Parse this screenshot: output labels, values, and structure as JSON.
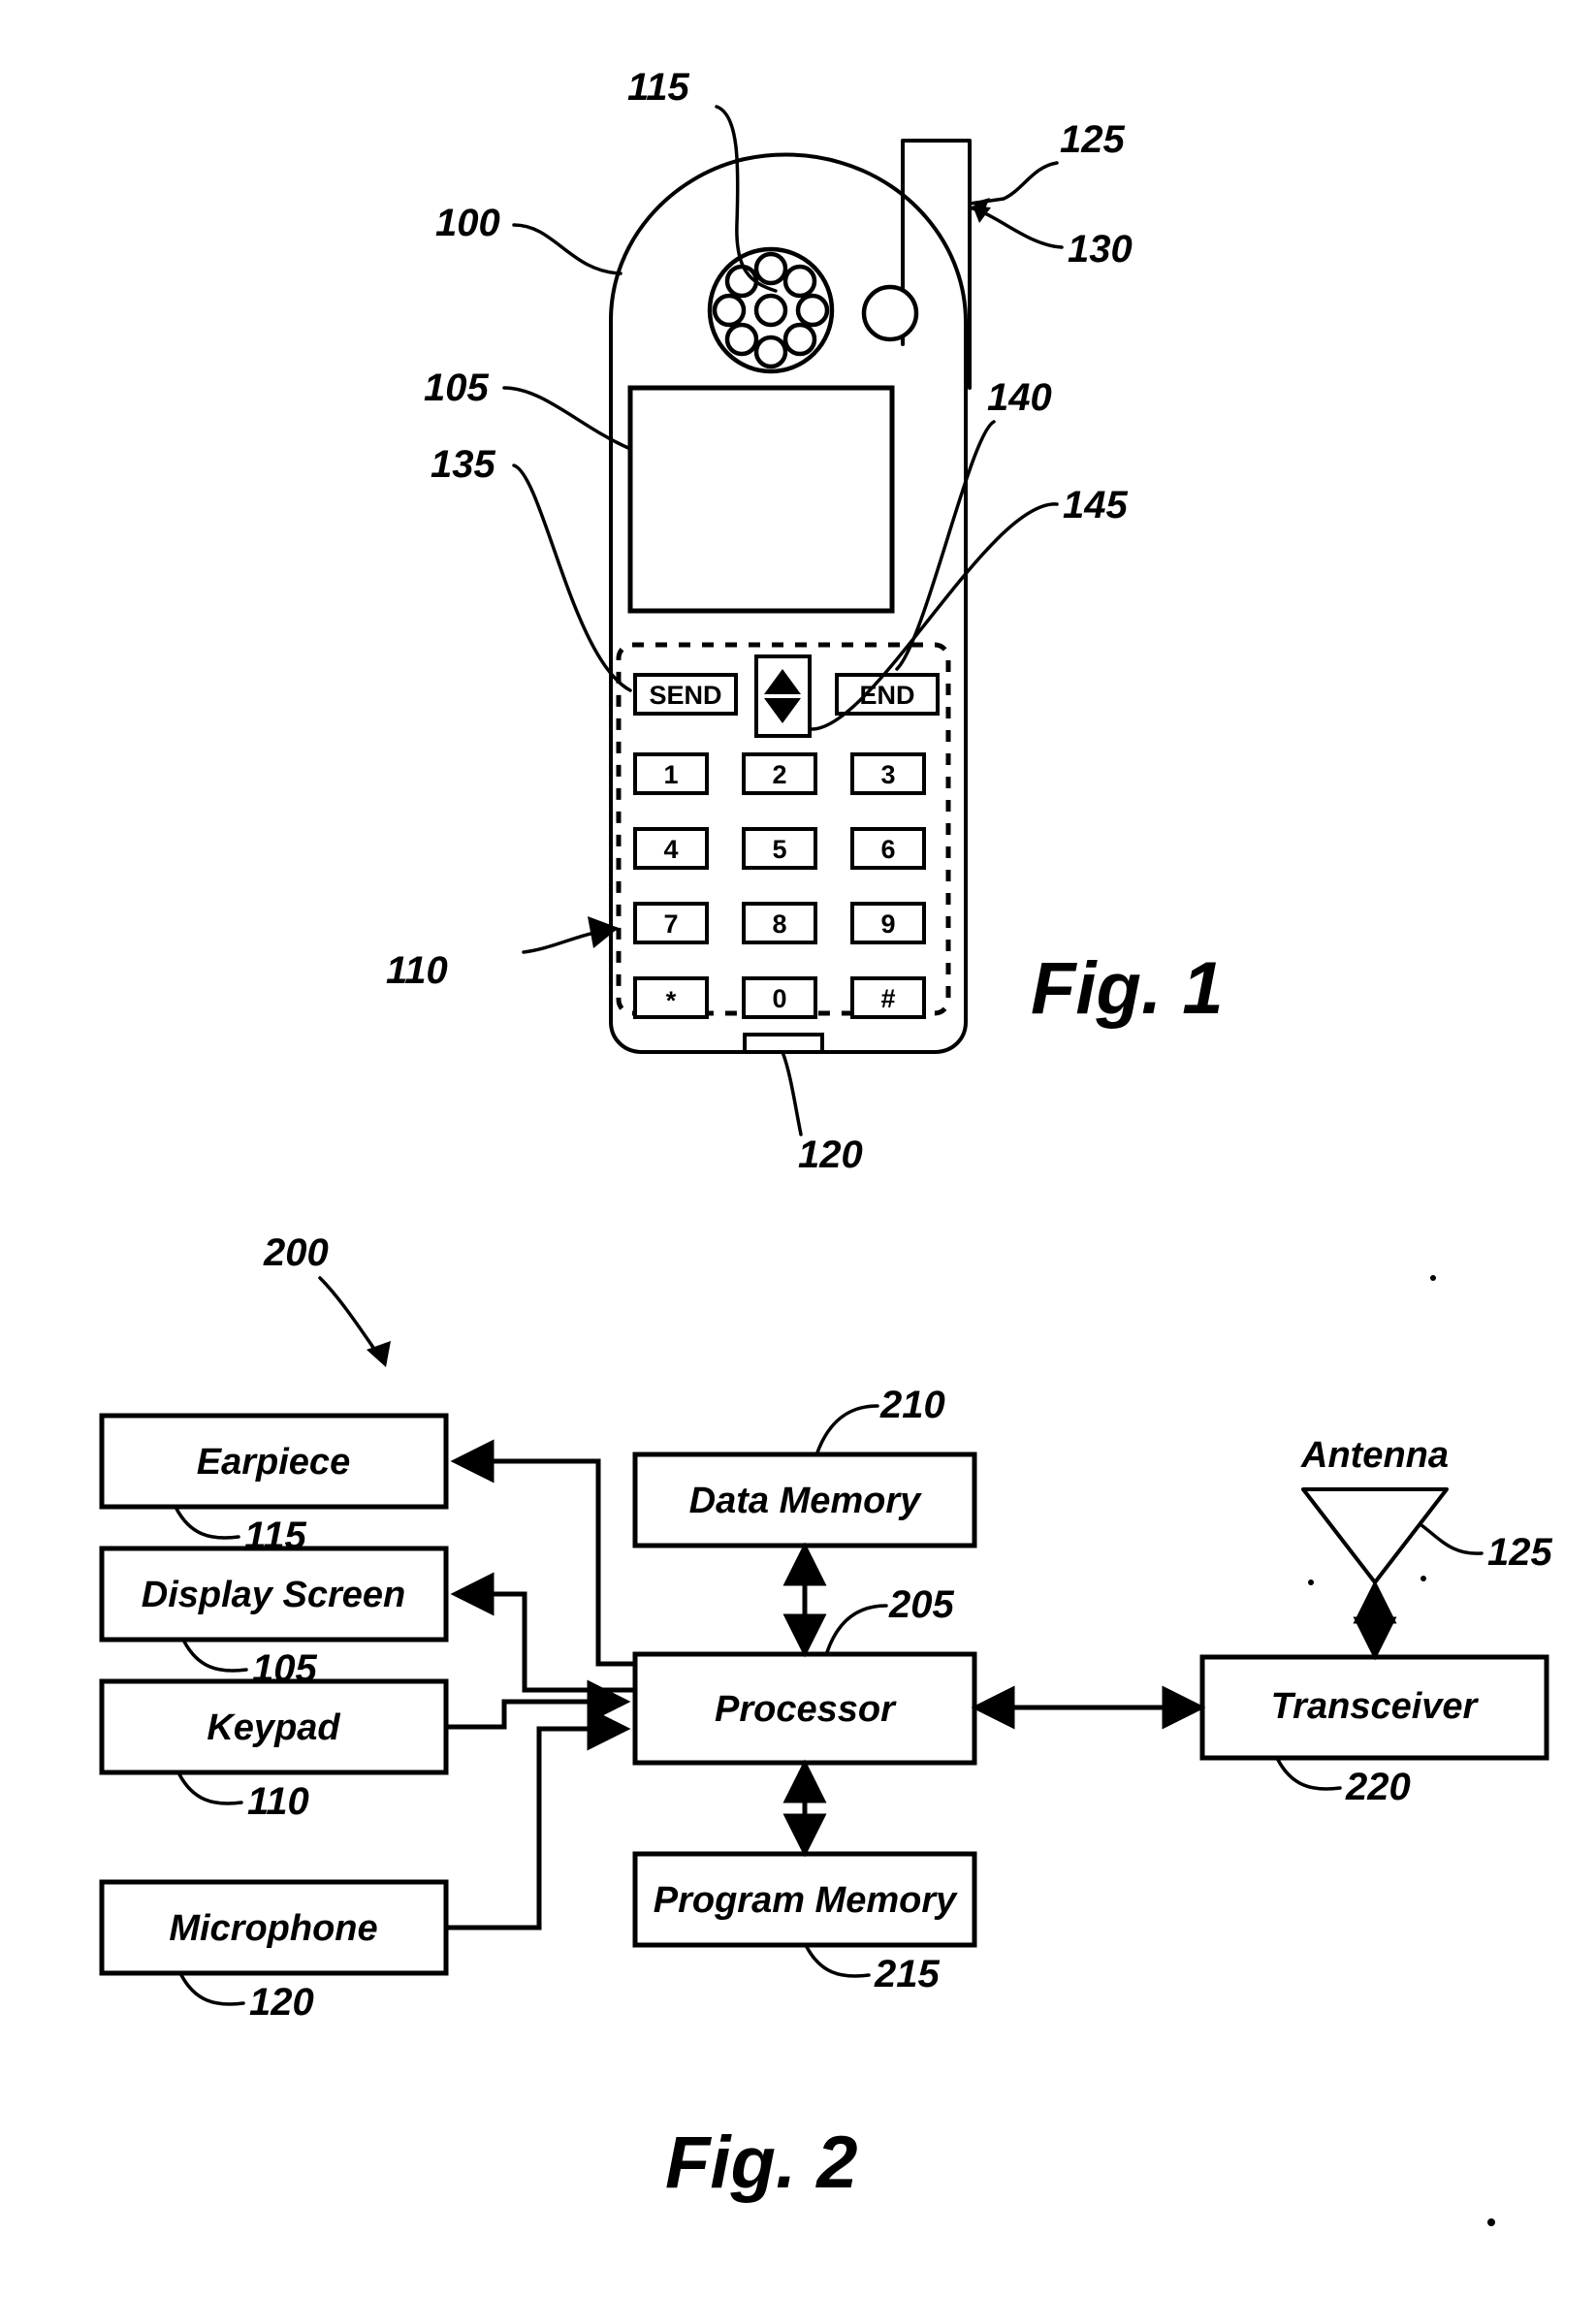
{
  "sheet": {
    "background": "#ffffff",
    "ink": "#000000"
  },
  "figure1": {
    "caption": "Fig. 1",
    "reference_numerals": {
      "handset_body": "100",
      "display_screen": "105",
      "keypad": "110",
      "earpiece": "115",
      "microphone": "120",
      "antenna": "125",
      "indicator": "130",
      "send_key": "135",
      "end_key": "140",
      "navigation_key": "145"
    },
    "keys": {
      "send_label": "SEND",
      "end_label": "END",
      "nav_up_glyph": "▲",
      "nav_down_glyph": "▼",
      "numeric": [
        [
          "1",
          "2",
          "3"
        ],
        [
          "4",
          "5",
          "6"
        ],
        [
          "7",
          "8",
          "9"
        ],
        [
          "*",
          "0",
          "#"
        ]
      ]
    },
    "earpiece_hole_count": 9
  },
  "figure2": {
    "caption": "Fig. 2",
    "system_numeral": "200",
    "blocks": [
      {
        "id": "earpiece",
        "label": "Earpiece",
        "numeral": "115"
      },
      {
        "id": "display-screen",
        "label": "Display Screen",
        "numeral": "105"
      },
      {
        "id": "keypad",
        "label": "Keypad",
        "numeral": "110"
      },
      {
        "id": "microphone",
        "label": "Microphone",
        "numeral": "120"
      },
      {
        "id": "data-memory",
        "label": "Data Memory",
        "numeral": "210"
      },
      {
        "id": "processor",
        "label": "Processor",
        "numeral": "205"
      },
      {
        "id": "program-memory",
        "label": "Program Memory",
        "numeral": "215"
      },
      {
        "id": "transceiver",
        "label": "Transceiver",
        "numeral": "220"
      },
      {
        "id": "antenna",
        "label": "Antenna",
        "numeral": "125"
      }
    ],
    "connections": [
      {
        "from": "processor",
        "to": "earpiece",
        "arrow": "single"
      },
      {
        "from": "processor",
        "to": "display-screen",
        "arrow": "single"
      },
      {
        "from": "keypad",
        "to": "processor",
        "arrow": "single"
      },
      {
        "from": "microphone",
        "to": "processor",
        "arrow": "single"
      },
      {
        "from": "data-memory",
        "to": "processor",
        "arrow": "double"
      },
      {
        "from": "program-memory",
        "to": "processor",
        "arrow": "double"
      },
      {
        "from": "processor",
        "to": "transceiver",
        "arrow": "double"
      },
      {
        "from": "transceiver",
        "to": "antenna",
        "arrow": "double"
      }
    ]
  }
}
